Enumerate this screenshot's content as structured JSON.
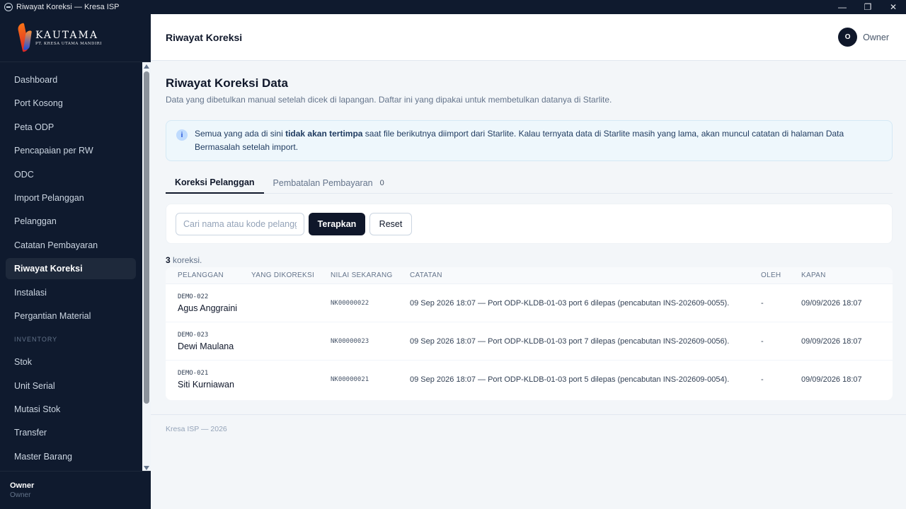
{
  "window": {
    "title": "Riwayat Koreksi — Kresa ISP",
    "minimize": "—",
    "maximize": "❐",
    "close": "✕"
  },
  "logo": {
    "brand": "KAUTAMA",
    "sub": "PT. KRESA UTAMA MANDIRI"
  },
  "sidebar": {
    "items": [
      {
        "label": "Dashboard"
      },
      {
        "label": "Port Kosong"
      },
      {
        "label": "Peta ODP"
      },
      {
        "label": "Pencapaian per RW"
      },
      {
        "label": "ODC"
      },
      {
        "label": "Import Pelanggan"
      },
      {
        "label": "Pelanggan"
      },
      {
        "label": "Catatan Pembayaran"
      },
      {
        "label": "Riwayat Koreksi",
        "active": true
      },
      {
        "label": "Instalasi"
      },
      {
        "label": "Pergantian Material"
      }
    ],
    "section_inventory": "INVENTORY",
    "inventory_items": [
      {
        "label": "Stok"
      },
      {
        "label": "Unit Serial"
      },
      {
        "label": "Mutasi Stok"
      },
      {
        "label": "Transfer"
      },
      {
        "label": "Master Barang"
      }
    ],
    "user": {
      "name": "Owner",
      "role": "Owner"
    }
  },
  "header": {
    "title": "Riwayat Koreksi",
    "avatar_initial": "O",
    "user_label": "Owner"
  },
  "main": {
    "title": "Riwayat Koreksi Data",
    "subtitle": "Data yang dibetulkan manual setelah dicek di lapangan. Daftar ini yang dipakai untuk membetulkan datanya di Starlite.",
    "info": {
      "icon": "i",
      "text_before": "Semua yang ada di sini ",
      "text_bold": "tidak akan tertimpa",
      "text_after": " saat file berikutnya diimport dari Starlite. Kalau ternyata data di Starlite masih yang lama, akan muncul catatan di halaman Data Bermasalah setelah import."
    },
    "tabs": [
      {
        "label": "Koreksi Pelanggan",
        "active": true
      },
      {
        "label": "Pembatalan Pembayaran",
        "count": "0"
      }
    ],
    "filter": {
      "placeholder": "Cari nama atau kode pelanggan",
      "value": "",
      "apply_label": "Terapkan",
      "reset_label": "Reset"
    },
    "result_count_number": "3",
    "result_count_suffix": " koreksi.",
    "table": {
      "headers": [
        "PELANGGAN",
        "YANG DIKOREKSI",
        "NILAI SEKARANG",
        "CATATAN",
        "OLEH",
        "KAPAN"
      ],
      "rows": [
        {
          "code": "DEMO-022",
          "name": "Agus Anggraini",
          "corrected": "",
          "current_value": "NK00000022",
          "note": "09 Sep 2026 18:07 — Port ODP-KLDB-01-03 port 6 dilepas (pencabutan INS-202609-0055).",
          "by": "-",
          "when": "09/09/2026 18:07"
        },
        {
          "code": "DEMO-023",
          "name": "Dewi Maulana",
          "corrected": "",
          "current_value": "NK00000023",
          "note": "09 Sep 2026 18:07 — Port ODP-KLDB-01-03 port 7 dilepas (pencabutan INS-202609-0056).",
          "by": "-",
          "when": "09/09/2026 18:07"
        },
        {
          "code": "DEMO-021",
          "name": "Siti Kurniawan",
          "corrected": "",
          "current_value": "NK00000021",
          "note": "09 Sep 2026 18:07 — Port ODP-KLDB-01-03 port 5 dilepas (pencabutan INS-202609-0054).",
          "by": "-",
          "when": "09/09/2026 18:07"
        }
      ]
    },
    "footer": "Kresa ISP — 2026"
  }
}
